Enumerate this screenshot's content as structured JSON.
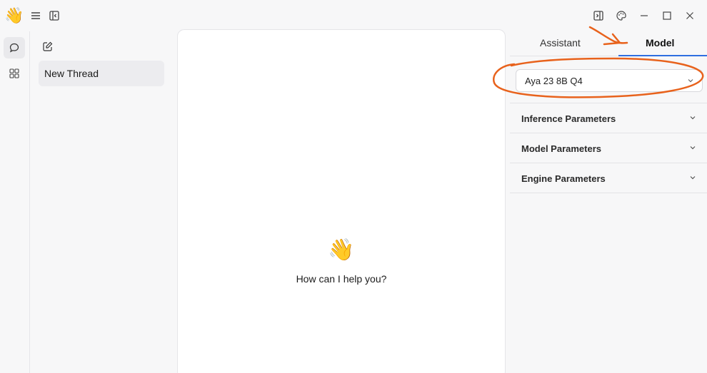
{
  "app": {
    "logo_icon": "waving-hand-icon",
    "logo_glyph": "👋"
  },
  "titlebar": {
    "icons": [
      "menu-icon",
      "collapse-sidebar-icon",
      "toggle-right-panel-icon",
      "palette-icon",
      "minimize-icon",
      "maximize-icon",
      "close-icon"
    ]
  },
  "rail": {
    "items": [
      {
        "icon": "chat-bubble-icon",
        "active": true
      },
      {
        "icon": "grid-icon",
        "active": false
      }
    ]
  },
  "threads": {
    "new_thread_icon": "edit-icon",
    "items": [
      {
        "label": "New Thread",
        "selected": true
      }
    ]
  },
  "chat": {
    "welcome_emoji": "👋",
    "welcome_text": "How can I help you?"
  },
  "right_panel": {
    "tabs": [
      {
        "label": "Assistant",
        "active": false
      },
      {
        "label": "Model",
        "active": true
      }
    ],
    "model_select": {
      "value": "Aya 23 8B Q4"
    },
    "sections": [
      {
        "label": "Inference Parameters"
      },
      {
        "label": "Model Parameters"
      },
      {
        "label": "Engine Parameters"
      }
    ]
  },
  "colors": {
    "accent": "#2f6fe0",
    "annotation": "#e8621c",
    "background": "#f7f7f8",
    "panel": "#ffffff"
  }
}
